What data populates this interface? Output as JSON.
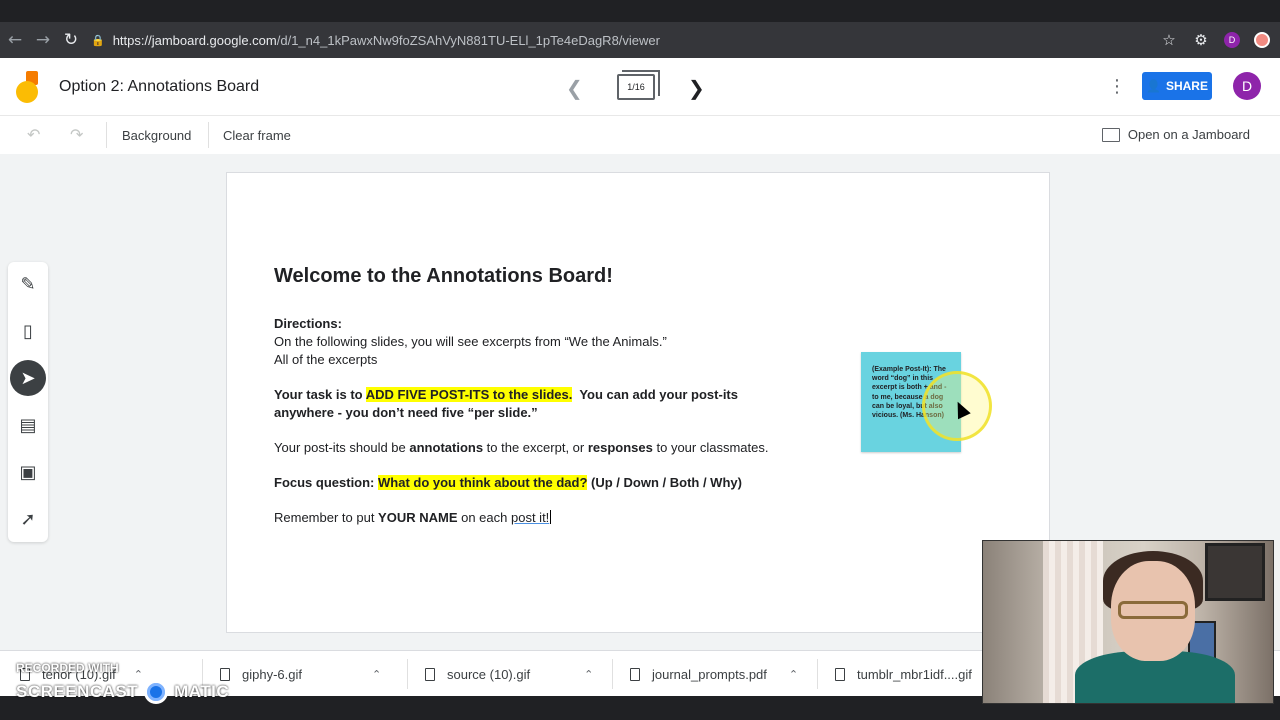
{
  "browser": {
    "url_host": "https://jamboard.google.com",
    "url_path": "/d/1_n4_1kPawxNw9foZSAhVyN881TU-ELl_1pTe4eDagR8/viewer",
    "profile_initial": "D"
  },
  "app": {
    "title": "Option 2: Annotations Board",
    "frame_counter": "1/16",
    "share_label": "SHARE",
    "avatar_initial": "D"
  },
  "toolbar": {
    "background_label": "Background",
    "clear_frame_label": "Clear frame",
    "open_on_jamboard_label": "Open on a Jamboard"
  },
  "tools": [
    "pen-icon",
    "eraser-icon",
    "select-icon",
    "sticky-note-icon",
    "image-icon",
    "laser-icon"
  ],
  "slide": {
    "heading": "Welcome to the Annotations Board!",
    "directions_label": "Directions:",
    "directions_line1": "On the following slides, you will see excerpts from “We the Animals.”",
    "directions_line2": "All of the excerpts",
    "task_prefix": "Your task is to ",
    "task_highlight": "ADD FIVE POST-ITS to the slides.",
    "task_suffix": "  You can add your post-its",
    "task_line2": "anywhere - you don’t need five “per slide.”",
    "postits_prefix": "Your post-its should be ",
    "postits_bold1": "annotations",
    "postits_mid": " to the excerpt, or ",
    "postits_bold2": "responses",
    "postits_suffix": " to your classmates.",
    "focus_label": "Focus question: ",
    "focus_highlight": "What do you think about the dad?",
    "focus_suffix": " (Up / Down / Both / Why)",
    "remember_prefix": "Remember to put ",
    "remember_bold": "YOUR NAME",
    "remember_mid": " on each ",
    "remember_link": "post it!"
  },
  "sticky_note": {
    "text": "(Example Post-It): The word “dog” in this excerpt is both + and - to me, because a dog can be loyal, but also vicious. (Ms. Hanson)",
    "color": "#69d3e0"
  },
  "downloads": [
    {
      "name": "tenor (10).gif"
    },
    {
      "name": "giphy-6.gif"
    },
    {
      "name": "source (10).gif"
    },
    {
      "name": "journal_prompts.pdf"
    },
    {
      "name": "tumblr_mbr1idf....gif"
    }
  ],
  "watermark": {
    "recorded_with": "RECORDED WITH",
    "brand_left": "SCREENCAST",
    "brand_right": "MATIC"
  }
}
